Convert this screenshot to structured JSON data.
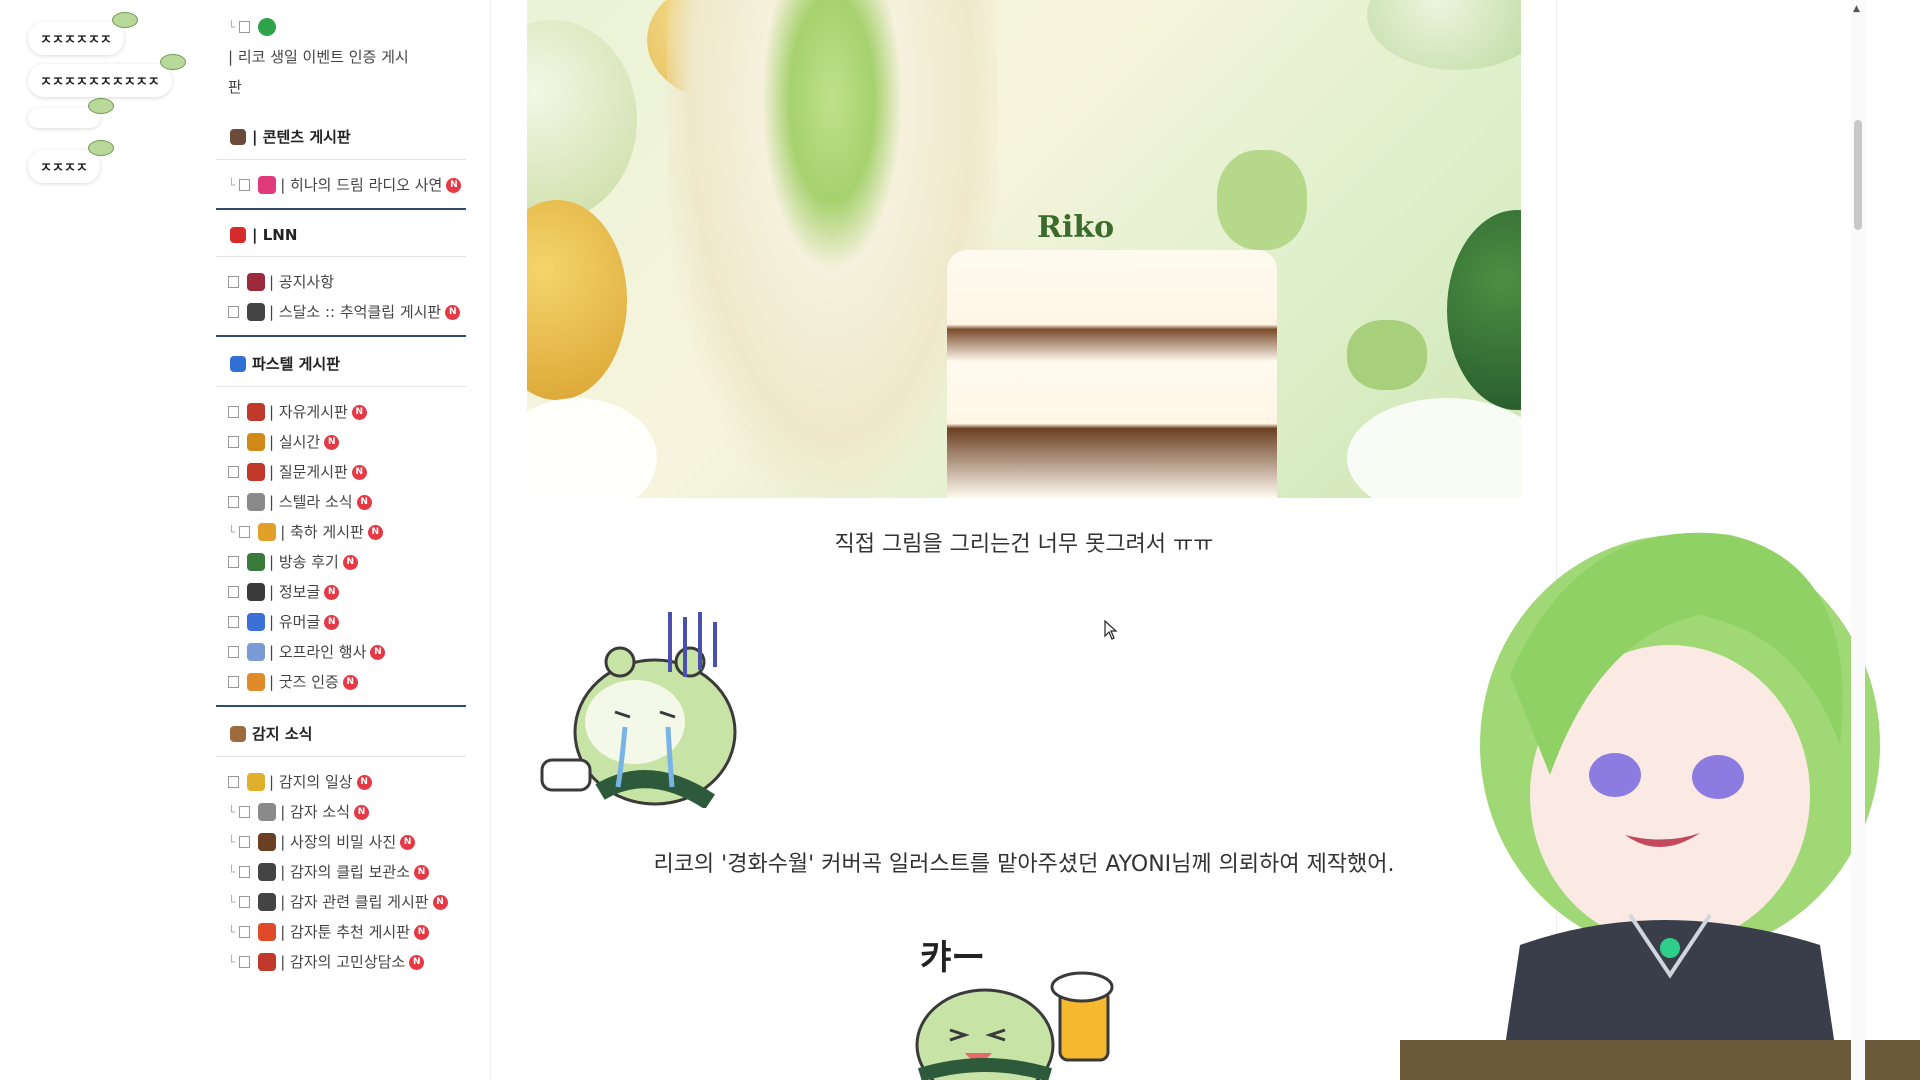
{
  "badges": [
    "ㅈㅈㅈㅈㅈㅈ",
    "ㅈㅈㅈㅈㅈㅈㅈㅈㅈㅈ",
    "ㅈㅈㅈㅈ"
  ],
  "sidebar": {
    "top_item": {
      "label": "| 리코 생일 이벤트 인증 게시판"
    },
    "sections": [
      {
        "title": "| 콘텐츠 게시판",
        "icon": "joystick-icon",
        "items": [
          {
            "label": "| 히나의 드림 라디오 사연",
            "new": true,
            "sub": true,
            "icon": "ribbon-icon"
          }
        ]
      },
      {
        "title": "| LNN",
        "icon": "drop-icon",
        "items": [
          {
            "label": "| 공지사항",
            "new": false,
            "sub": false,
            "icon": "wine-icon"
          },
          {
            "label": "| 스달소 :: 추억클립 게시판",
            "new": true,
            "sub": false,
            "icon": "film-icon"
          }
        ]
      },
      {
        "title": "파스텔 게시판",
        "icon": "brush-icon",
        "items": [
          {
            "label": "| 자유게시판",
            "new": true,
            "sub": false,
            "icon": "pencil-icon"
          },
          {
            "label": "| 실시간",
            "new": true,
            "sub": false,
            "icon": "hourglass-icon"
          },
          {
            "label": "| 질문게시판",
            "new": true,
            "sub": false,
            "icon": "question-icon"
          },
          {
            "label": "| 스텔라 소식",
            "new": true,
            "sub": false,
            "icon": "newspaper-icon"
          },
          {
            "label": "| 축하 게시판",
            "new": true,
            "sub": true,
            "icon": "party-icon"
          },
          {
            "label": "| 방송 후기",
            "new": true,
            "sub": false,
            "icon": "books-icon"
          },
          {
            "label": "| 정보글",
            "new": true,
            "sub": false,
            "icon": "monitor-icon"
          },
          {
            "label": "| 유머글",
            "new": true,
            "sub": false,
            "icon": "rocket-icon"
          },
          {
            "label": "| 오프라인 행사",
            "new": true,
            "sub": false,
            "icon": "calendar-icon"
          },
          {
            "label": "| 굿즈 인증",
            "new": true,
            "sub": false,
            "icon": "gift-icon"
          }
        ]
      },
      {
        "title": "감지 소식",
        "icon": "potato-icon",
        "items": [
          {
            "label": "| 감지의 일상",
            "new": true,
            "sub": false,
            "icon": "beer-icon"
          },
          {
            "label": "| 감자 소식",
            "new": true,
            "sub": true,
            "icon": "newspaper-icon"
          },
          {
            "label": "| 사장의 비밀 사진",
            "new": true,
            "sub": true,
            "icon": "briefcase-icon"
          },
          {
            "label": "| 감자의 클립 보관소",
            "new": true,
            "sub": true,
            "icon": "film-icon"
          },
          {
            "label": "| 감자 관련 클립 게시판",
            "new": true,
            "sub": true,
            "icon": "film-icon"
          },
          {
            "label": "| 감자툰 추천 게시판",
            "new": true,
            "sub": true,
            "icon": "fries-icon"
          },
          {
            "label": "| 감자의 고민상담소",
            "new": true,
            "sub": true,
            "icon": "question-icon"
          }
        ]
      }
    ],
    "new_badge": "N"
  },
  "article": {
    "caption1": "직접 그림을 그리는건 너무 못그려서 ㅠㅠ",
    "caption2": "리코의 '경화수월' 커버곡 일러스트를 맡아주셨던 AYONI님께 의뢰하여 제작했어.",
    "hero_cake_text": "Riko",
    "sticker2_text": "캬ー"
  },
  "colors": {
    "section_border": "#2f4e6e",
    "new_badge": "#e63946",
    "accent_green": "#a6d16d"
  }
}
